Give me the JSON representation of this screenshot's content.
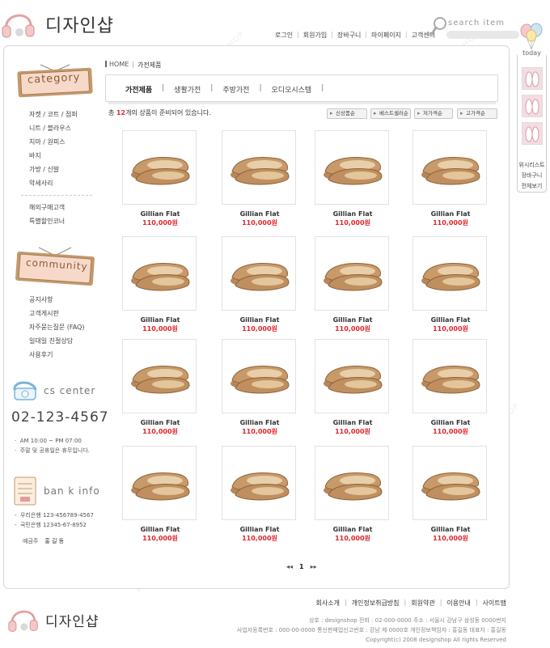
{
  "header": {
    "logo_text": "디자인샵",
    "nav": [
      "로그인",
      "회원가입",
      "장바구니",
      "마이페이지",
      "고객센터"
    ],
    "search_label": "search item"
  },
  "sidebar": {
    "category_title": "category",
    "categories": [
      "자켓 / 코트 / 점퍼",
      "니트 / 블라우스",
      "치마 / 원피스",
      "바지",
      "가방 / 신발",
      "악세사리"
    ],
    "special": [
      "해외구매고객",
      "특별할인코너"
    ],
    "community_title": "community",
    "community": [
      "공지사항",
      "고객게시판",
      "자주묻는질문 (FAQ)",
      "일대일 친절상담",
      "사용후기"
    ],
    "cs_title": "cs center",
    "cs_phone": "02-123-4567",
    "cs_hours": "AM 10:00 ~ PM 07:00",
    "cs_holiday": "주말 및 공휴일은 휴무입니다.",
    "bank_title": "ban k info",
    "banks": [
      "우리은행  123-456789-4567",
      "국민은행  12345-67-8952"
    ],
    "holder_label": "예금주",
    "holder_name": "홍 길 동"
  },
  "breadcrumb": {
    "home": "HOME",
    "current": "가전제품"
  },
  "tabs": [
    {
      "label": "가전제품",
      "active": true
    },
    {
      "label": "생활가전",
      "active": false
    },
    {
      "label": "주방가전",
      "active": false
    },
    {
      "label": "오디오시스템",
      "active": false
    }
  ],
  "count": {
    "prefix": "총",
    "number": "12",
    "suffix": "개의 상품이 준비되어 있습니다."
  },
  "sort_buttons": [
    "신상품순",
    "베스트셀러순",
    "저가격순",
    "고가격순"
  ],
  "products": [
    {
      "name": "Gillian Flat",
      "price": "110,000원"
    },
    {
      "name": "Gillian Flat",
      "price": "110,000원"
    },
    {
      "name": "Gillian Flat",
      "price": "110,000원"
    },
    {
      "name": "Gillian Flat",
      "price": "110,000원"
    },
    {
      "name": "Gillian Flat",
      "price": "110,000원"
    },
    {
      "name": "Gillian Flat",
      "price": "110,000원"
    },
    {
      "name": "Gillian Flat",
      "price": "110,000원"
    },
    {
      "name": "Gillian Flat",
      "price": "110,000원"
    },
    {
      "name": "Gillian Flat",
      "price": "110,000원"
    },
    {
      "name": "Gillian Flat",
      "price": "110,000원"
    },
    {
      "name": "Gillian Flat",
      "price": "110,000원"
    },
    {
      "name": "Gillian Flat",
      "price": "110,000원"
    },
    {
      "name": "Gillian Flat",
      "price": "110,000원"
    },
    {
      "name": "Gillian Flat",
      "price": "110,000원"
    },
    {
      "name": "Gillian Flat",
      "price": "110,000원"
    },
    {
      "name": "Gillian Flat",
      "price": "110,000원"
    }
  ],
  "pagination": {
    "prev": "◂◂",
    "current": "1",
    "next": "▸▸"
  },
  "right_rail": {
    "today_label": "today",
    "links": [
      "위시리스트",
      "장바구니",
      "전체보기"
    ]
  },
  "footer": {
    "logo_text": "디자인샵",
    "links": [
      "회사소개",
      "개인정보취급방침",
      "회원약관",
      "이용안내",
      "사이트맵"
    ],
    "info_line1": "상호 : designshop    전화 : 02-000-0000    주소 : 서울시 강남구 삼성동 0000번지",
    "info_line2": "사업자등록번호 : 000-00-0000    통신판매업신고번호 : 강남 제 0000호    개인정보책임자 : 홍길동    대표자 : 홍길동",
    "copyright": "Copyright(c) 2008 designshop All rights Reserved"
  },
  "colors": {
    "price_red": "#e0262b",
    "sign_pink": "#e59a9a",
    "sign_wood": "#c49a6c",
    "border_gray": "#d6d6d6"
  }
}
